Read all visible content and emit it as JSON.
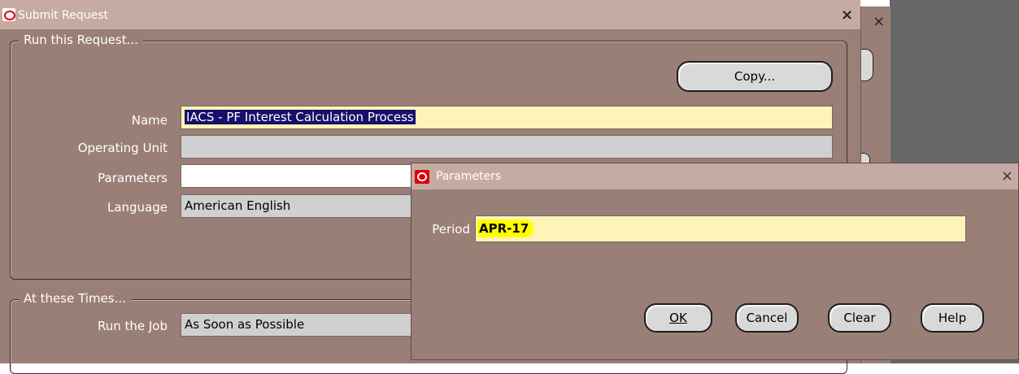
{
  "main_window": {
    "title": "Submit Request",
    "close_symbol": "×",
    "section_run": "Run this Request...",
    "copy_button": "Copy...",
    "fields": {
      "name_label": "Name",
      "name_value": "IACS - PF Interest Calculation Process",
      "operating_unit_label": "Operating Unit",
      "operating_unit_value": "",
      "parameters_label": "Parameters",
      "parameters_value": "",
      "language_label": "Language",
      "language_value": "American English"
    },
    "section_times": "At these Times...",
    "run_job_label": "Run the Job",
    "run_job_value": "As Soon as Possible"
  },
  "background_window": {
    "close_symbol": "×"
  },
  "parameters_dialog": {
    "title": "Parameters",
    "close_symbol": "×",
    "period_label": "Period",
    "period_value": "APR-17",
    "buttons": {
      "ok": "OK",
      "cancel": "Cancel",
      "clear": "Clear",
      "help": "Help"
    }
  },
  "colors": {
    "window_bg": "#9a7f77",
    "titlebar": "#c6aba4",
    "field_yellow": "#fff4b8",
    "highlight": "#ffff00",
    "selection": "#16106a",
    "desktop_grey": "#676767"
  }
}
